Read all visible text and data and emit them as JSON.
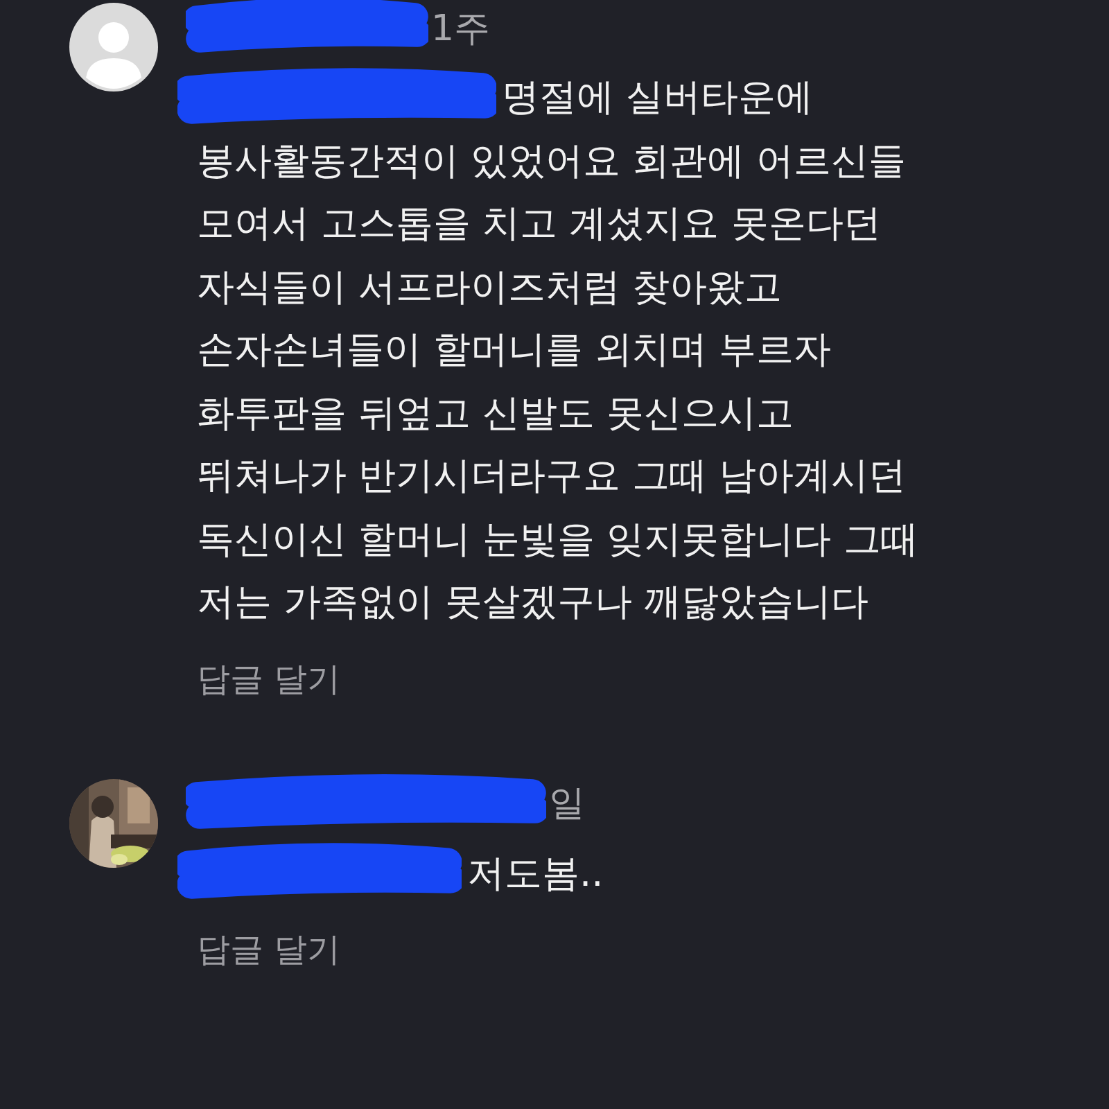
{
  "comments": [
    {
      "avatar": {
        "kind": "default"
      },
      "time": "1주",
      "lines": [
        "명절에 실버타운에",
        "봉사활동간적이 있었어요 회관에 어르신들",
        "모여서 고스톱을 치고 계셨지요 못온다던",
        "자식들이 서프라이즈처럼 찾아왔고",
        "손자손녀들이 할머니를 외치며 부르자",
        "화투판을 뒤엎고 신발도 못신으시고",
        "뛰쳐나가 반기시더라구요 그때 남아계시던",
        "독신이신 할머니 눈빛을 잊지못합니다 그때",
        "저는 가족없이 못살겠구나 깨닳았습니다"
      ],
      "reply": "답글 달기"
    },
    {
      "avatar": {
        "kind": "picture"
      },
      "time": "일",
      "lines": [
        "저도봄.."
      ],
      "reply": "답글 달기"
    }
  ]
}
